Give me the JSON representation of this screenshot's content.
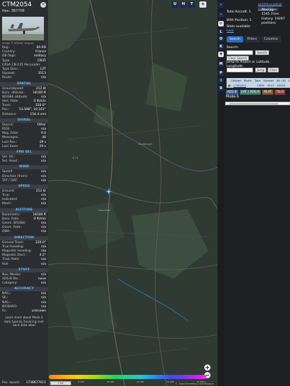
{
  "aircraft": {
    "callsign": "CTM2054",
    "hex": "Hex: 3B770E",
    "photo_credit": "Image © William Verguet"
  },
  "basic": [
    {
      "k": "Reg.:",
      "v": "64-XD"
    },
    {
      "k": "Country:",
      "v": "France"
    },
    {
      "k": "DB flags:",
      "v": "military"
    },
    {
      "k": "Type:",
      "v": "CN35"
    },
    {
      "k": "CASA CN-235 Persuader",
      "v": ""
    },
    {
      "k": "Type Desc.:",
      "v": "L2T"
    },
    {
      "k": "Squawk:",
      "v": "3513"
    },
    {
      "k": "Route:",
      "v": "n/a"
    }
  ],
  "sections": {
    "spatial": "SPATIAL",
    "signal": "SIGNAL",
    "fms": "FMS SEL",
    "wind": "WIND",
    "speed": "SPEED",
    "altitude": "ALTITUDE",
    "direction": "DIRECTION",
    "stuff": "STUFF",
    "accuracy": "ACCURACY"
  },
  "spatial": [
    {
      "k": "Groundspeed:",
      "v": "212 kt"
    },
    {
      "k": "Baro. altitude:",
      "v": "18100 ft"
    },
    {
      "k": "WGS84 altitude:",
      "v": "n/a"
    },
    {
      "k": "Vert. Rate:",
      "v": "0 ft/min"
    },
    {
      "k": "Track:",
      "v": "220.0°"
    },
    {
      "k": "Pos.:",
      "v": "53.598°, 10.161°"
    },
    {
      "k": "Distance:",
      "v": "154.4 nmi"
    }
  ],
  "signal": [
    {
      "k": "Source:",
      "v": "Other"
    },
    {
      "k": "RSSI:",
      "v": "n/a"
    },
    {
      "k": "Msg. Rate:",
      "v": "0.0"
    },
    {
      "k": "Messages:",
      "v": "46"
    },
    {
      "k": "Last Pos.:",
      "v": "29 s"
    },
    {
      "k": "Last Seen:",
      "v": "29 s"
    }
  ],
  "fms": [
    {
      "k": "Sel. Alt.:",
      "v": "n/a"
    },
    {
      "k": "Sel. Head.:",
      "v": "n/a"
    }
  ],
  "wind": [
    {
      "k": "Speed:",
      "v": "n/a"
    },
    {
      "k": "Direction (from):",
      "v": "n/a"
    },
    {
      "k": "TAT / OAT:",
      "v": "n/a"
    }
  ],
  "speed": [
    {
      "k": "Ground:",
      "v": "212 kt"
    },
    {
      "k": "True:",
      "v": "n/a"
    },
    {
      "k": "Indicated:",
      "v": "n/a"
    },
    {
      "k": "Mach:",
      "v": "n/a"
    }
  ],
  "altitude": [
    {
      "k": "Barometric:",
      "v": "18100 ft"
    },
    {
      "k": "Baro. Rate:",
      "v": "0 ft/min"
    },
    {
      "k": "Geom. WGS84:",
      "v": "n/a"
    },
    {
      "k": "Geom. Rate:",
      "v": "n/a"
    },
    {
      "k": "QNH:",
      "v": "n/a"
    }
  ],
  "direction": [
    {
      "k": "Ground Track:",
      "v": "220.0°"
    },
    {
      "k": "True Heading:",
      "v": "n/a"
    },
    {
      "k": "Magnetic Heading:",
      "v": "n/a"
    },
    {
      "k": "Magnetic Decl.:",
      "v": "4.2°"
    },
    {
      "k": "Track Rate:",
      "v": "n/a"
    },
    {
      "k": "Roll:",
      "v": "n/a"
    }
  ],
  "stuff": [
    {
      "k": "Nav. Modes:",
      "v": "n/a"
    },
    {
      "k": "ADS-B Ver.:",
      "v": "none"
    },
    {
      "k": "Category:",
      "v": "n/a"
    }
  ],
  "accuracy": [
    {
      "k": "NACₚ:",
      "v": "n/a"
    },
    {
      "k": "SIL:",
      "v": "n/a"
    },
    {
      "k": "NACᵥ:",
      "v": "n/a"
    },
    {
      "k": "NICBARO:",
      "v": "n/a"
    },
    {
      "k": "Rc:",
      "v": "unknown"
    }
  ],
  "learn_more": "Learn more about Mode S data type by hovering over each data label",
  "epoch": {
    "k": "Pos. epoch:",
    "v": "1738677611"
  },
  "map": {
    "top_buttons": [
      "U",
      "H",
      "T"
    ],
    "side_buttons": [
      "L",
      "O",
      "K",
      "M",
      "P",
      "I",
      "R"
    ],
    "zoom_in": "+",
    "zoom_out": "−",
    "scale_labels": [
      "6 000",
      "8 000",
      "10 000",
      "20 000",
      "30 000",
      "40 000+"
    ],
    "scale_bar": "2 km",
    "attribution": "© OpenStreetMap contributors."
  },
  "stats": {
    "github_link": "tar1090 on github (3.14.1352)",
    "total_label": "Total Aircraft: 1",
    "messages_label": "Messages:",
    "messages_value": "1545.7/sec",
    "with_positions": "With Position: 1",
    "history_label": "History: 19297",
    "history_sub": "positions",
    "stats_available": "Stats available",
    "here": "here"
  },
  "tabs": [
    "Search",
    "Filters",
    "Columns"
  ],
  "search": {
    "label": "Search:",
    "button": "Search",
    "clear": "Clear Search",
    "jump_label": "Jump to Airport or Latitude, Longitude:",
    "jump_button": "Jump",
    "clear2": "Clear"
  },
  "table": {
    "headers": [
      "Callsign",
      "Route",
      "Type",
      "Squawk",
      "Alt. (ft)",
      "Sp"
    ],
    "row": [
      "CTM2054",
      "",
      "CN35",
      "3513",
      "18100"
    ]
  },
  "badges": [
    "ADS-B",
    "UAT / ADS-R",
    "MLAT",
    "TIS-B"
  ],
  "mode_s": "Mode-S",
  "colors": {
    "accent": "#2b6cc4",
    "section": "#5fb8ff",
    "panel": "#2b2d30",
    "map": "#2f3b33"
  }
}
